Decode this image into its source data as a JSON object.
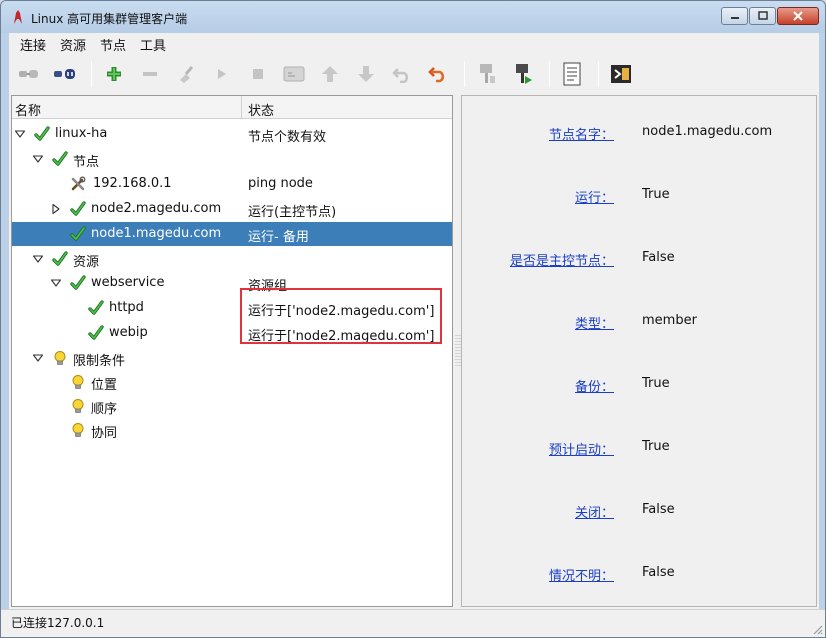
{
  "window": {
    "title": "Linux 高可用集群管理客户端"
  },
  "menu": {
    "connect": "连接",
    "resources": "资源",
    "nodes": "节点",
    "tools": "工具"
  },
  "toolbar": {
    "icons": [
      "connect-icon",
      "disconnect-icon",
      "add-icon",
      "remove-icon",
      "cleanup-icon",
      "start-icon",
      "stop-icon",
      "default-icon",
      "move-up-icon",
      "move-down-icon",
      "undo-icon",
      "redo-icon",
      "standby-icon",
      "active-icon",
      "log-icon",
      "exit-icon"
    ]
  },
  "tree": {
    "col_name": "名称",
    "col_status": "状态",
    "rows": [
      {
        "name": "linux-ha",
        "status": "节点个数有效"
      },
      {
        "name": "节点",
        "status": ""
      },
      {
        "name": "192.168.0.1",
        "status": "ping node"
      },
      {
        "name": "node2.magedu.com",
        "status": "运行(主控节点)"
      },
      {
        "name": "node1.magedu.com",
        "status": "运行- 备用"
      },
      {
        "name": "资源",
        "status": ""
      },
      {
        "name": "webservice",
        "status": "资源组"
      },
      {
        "name": "httpd",
        "status": "运行于['node2.magedu.com']"
      },
      {
        "name": "webip",
        "status": "运行于['node2.magedu.com']"
      },
      {
        "name": "限制条件",
        "status": ""
      },
      {
        "name": "位置",
        "status": ""
      },
      {
        "name": "顺序",
        "status": ""
      },
      {
        "name": "协同",
        "status": ""
      }
    ]
  },
  "details": [
    {
      "label": "节点名字：",
      "value": "node1.magedu.com"
    },
    {
      "label": "运行：",
      "value": "True"
    },
    {
      "label": "是否是主控节点：",
      "value": "False"
    },
    {
      "label": "类型：",
      "value": "member"
    },
    {
      "label": "备份：",
      "value": "True"
    },
    {
      "label": "预计启动：",
      "value": "True"
    },
    {
      "label": "关闭：",
      "value": "False"
    },
    {
      "label": "情况不明：",
      "value": "False"
    }
  ],
  "status": {
    "text": "已连接127.0.0.1"
  },
  "colors": {
    "selection": "#3c7fb8",
    "highlight_border": "#e2333a",
    "link": "#1a3ec8"
  }
}
